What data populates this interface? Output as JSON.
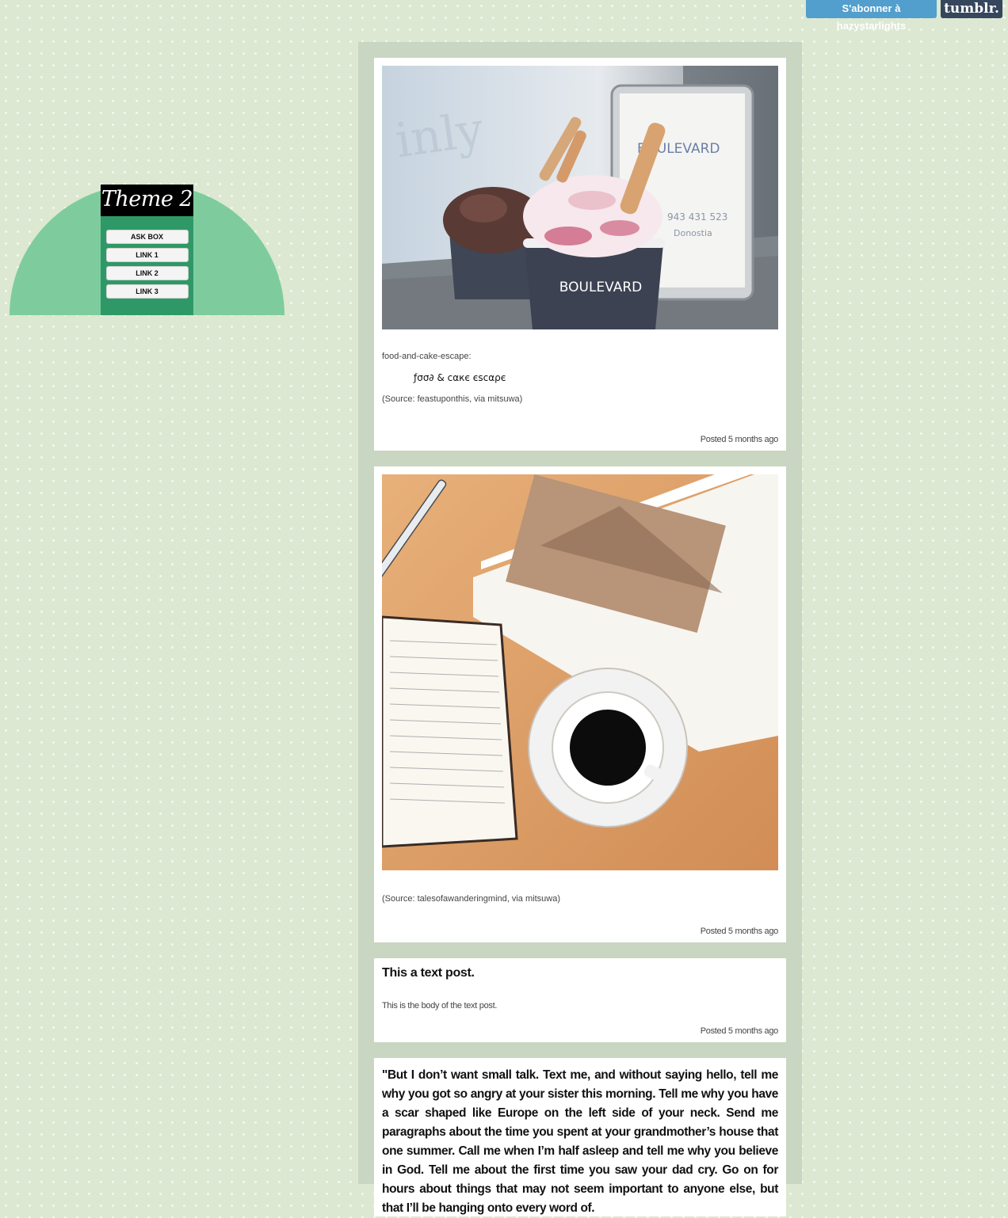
{
  "tumblr": {
    "subscribe_label": "S'abonner à hazystarlights",
    "logo_label": "tumblr."
  },
  "sidebar": {
    "title": "Theme 2",
    "links": [
      "ASK BOX",
      "LINK 1",
      "LINK 2",
      "LINK 3"
    ]
  },
  "posts": [
    {
      "type": "photo",
      "image": "ice-cream-cups-photo",
      "source_blog": "food-and-cake-escape:",
      "stylized_text": "ƒσσ∂ & cαкє єѕcαρє",
      "source_line": "(Source: feastuponthis, via mitsuwa)",
      "meta": "Posted 5 months ago"
    },
    {
      "type": "photo",
      "image": "journal-coffee-book-photo",
      "source_line": "(Source: talesofawanderingmind, via mitsuwa)",
      "meta": "Posted 5 months ago"
    },
    {
      "type": "text",
      "title": "This a text post.",
      "body": "This is the body of the text post.",
      "meta": "Posted 5 months ago"
    },
    {
      "type": "quote",
      "text": "\"But I don’t want small talk. Text me, and without saying hello, tell me why you got so angry at your sister this morning. Tell me why you have a scar shaped like Europe on the left side of your neck. Send me paragraphs about the time you spent at your grandmother’s house that one summer. Call me when I’m half asleep and tell me why you believe in God. Tell me about the first time you saw your dad cry. Go on for hours about things that may not seem important to anyone else, but that I’ll be hanging onto every word of."
    }
  ]
}
